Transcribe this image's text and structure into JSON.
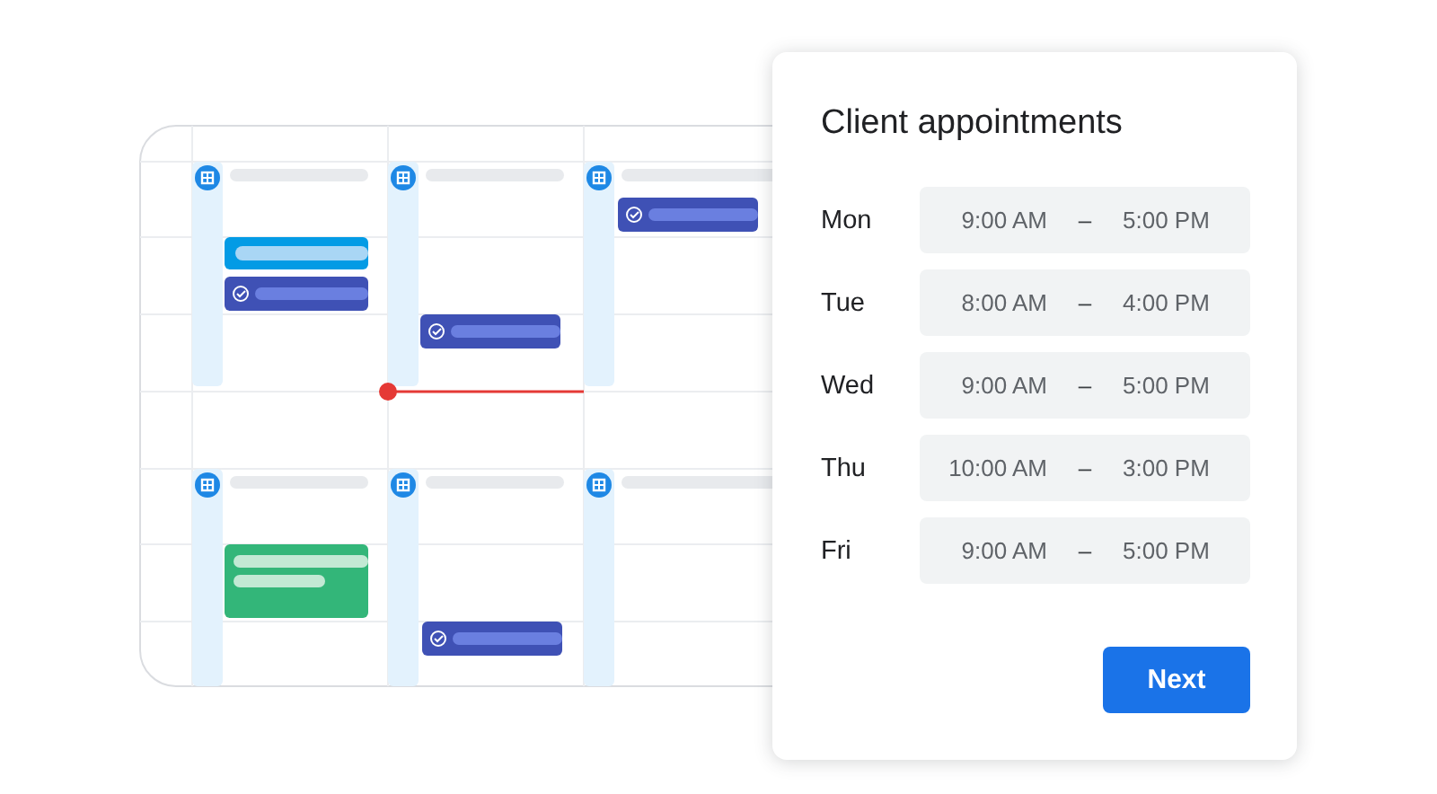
{
  "dialog": {
    "title": "Client appointments",
    "days": [
      {
        "day": "Mon",
        "start": "9:00 AM",
        "separator": "–",
        "end": "5:00 PM"
      },
      {
        "day": "Tue",
        "start": "8:00 AM",
        "separator": "–",
        "end": "4:00 PM"
      },
      {
        "day": "Wed",
        "start": "9:00 AM",
        "separator": "–",
        "end": "5:00 PM"
      },
      {
        "day": "Thu",
        "start": "10:00 AM",
        "separator": "–",
        "end": "3:00 PM"
      },
      {
        "day": "Fri",
        "start": "9:00 AM",
        "separator": "–",
        "end": "5:00 PM"
      }
    ],
    "button": "Next"
  }
}
